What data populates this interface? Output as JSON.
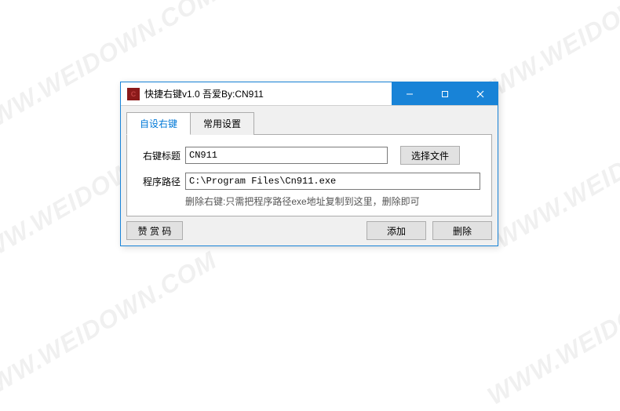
{
  "watermark": "WWW.WEIDOWN.COM",
  "window": {
    "title": "快捷右键v1.0 吾爱By:CN911"
  },
  "tabs": {
    "active": "自设右键",
    "inactive": "常用设置"
  },
  "form": {
    "title_label": "右键标题",
    "title_value": "CN911",
    "path_label": "程序路径",
    "path_value": "C:\\Program Files\\Cn911.exe",
    "select_file": "选择文件",
    "hint": "删除右键:只需把程序路径exe地址复制到这里，删除即可"
  },
  "buttons": {
    "reward": "赞 赏 码",
    "add": "添加",
    "delete": "删除"
  }
}
